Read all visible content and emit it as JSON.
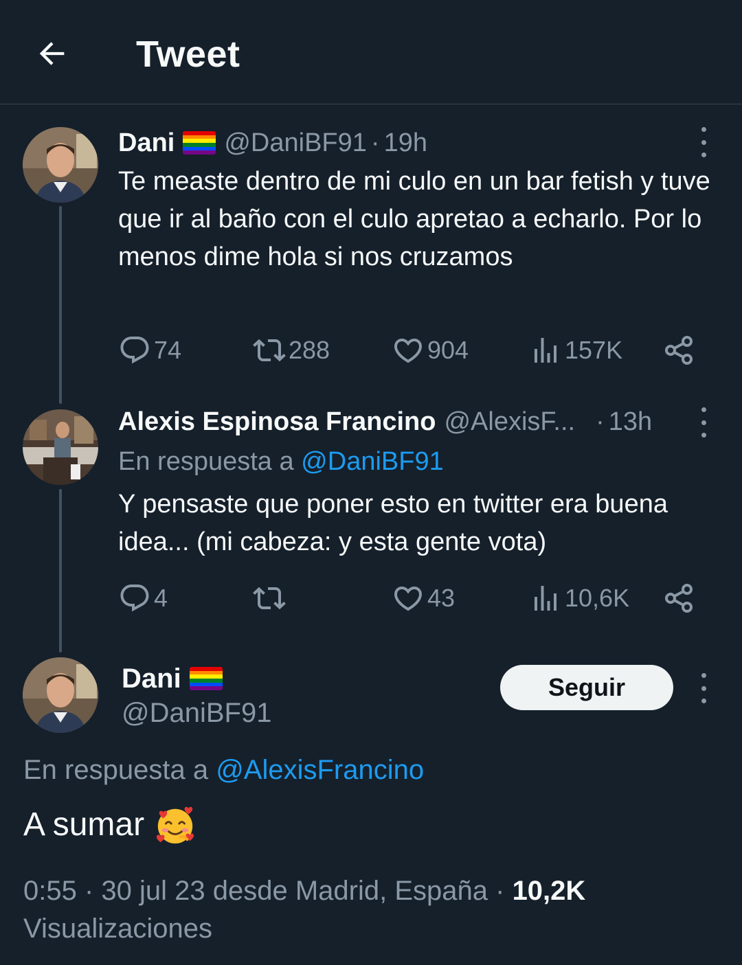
{
  "header": {
    "title": "Tweet",
    "back_icon": "arrow-left-icon"
  },
  "tweets": [
    {
      "name": "Dani",
      "handle": "@DaniBF91",
      "separator": "·",
      "time": "19h",
      "text": "Te measte dentro de mi culo en un bar fetish y tuve que ir al baño con el culo apretao a echarlo. Por lo menos dime hola si nos cruzamos",
      "stats": {
        "replies": "74",
        "retweets": "288",
        "likes": "904",
        "views": "157K"
      }
    },
    {
      "name": "Alexis Espinosa Francino",
      "handle": "@AlexisF...",
      "separator": "·",
      "time": "13h",
      "reply_prefix": "En respuesta a",
      "reply_to": "@DaniBF91",
      "text": "Y pensaste que poner esto en twitter era buena idea...  (mi cabeza: y esta gente vota)",
      "stats": {
        "replies": "4",
        "retweets": "",
        "likes": "43",
        "views": "10,6K"
      }
    }
  ],
  "main_tweet": {
    "name": "Dani",
    "handle": "@DaniBF91",
    "follow_label": "Seguir",
    "reply_prefix": "En respuesta a",
    "reply_to": "@AlexisFrancino",
    "text": "A sumar",
    "timestamp": "0:55 · 30 jul 23 desde Madrid, España ·",
    "views_count": "10,2K",
    "views_label": "Visualizaciones"
  },
  "colors": {
    "background": "#15202b",
    "text": "#f7f9f9",
    "secondary": "#8b98a5",
    "accent": "#1d9bf0",
    "divider": "#38444d"
  }
}
